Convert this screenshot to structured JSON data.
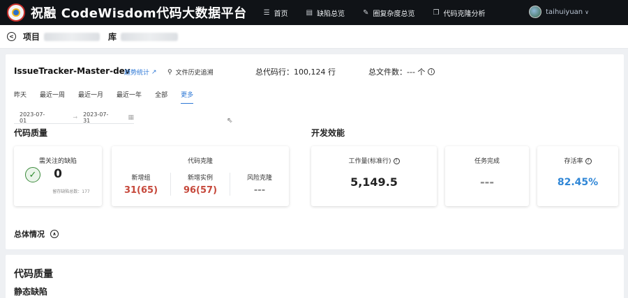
{
  "header": {
    "brand": "祝融 CodeWisdom代码大数据平台",
    "nav": [
      {
        "label": "首页",
        "icon": "menu-icon"
      },
      {
        "label": "缺陷总览",
        "icon": "document-icon"
      },
      {
        "label": "圈复杂度总览",
        "icon": "wrench-icon"
      },
      {
        "label": "代码克隆分析",
        "icon": "copy-icon"
      }
    ],
    "user": "taihuiyuan"
  },
  "breadcrumb": {
    "project_label": "项目",
    "repo_label": "库"
  },
  "repo": {
    "title": "IssueTracker-Master-dev",
    "trend_link": "趋势统计",
    "history_link": "文件历史追溯",
    "total_lines": "总代码行：100,124 行",
    "total_files": "总文件数：--- 个"
  },
  "tabs": [
    "昨天",
    "最近一周",
    "最近一月",
    "最近一年",
    "全部",
    "更多"
  ],
  "active_tab": "更多",
  "date_range": {
    "start": "2023-07-01",
    "end": "2023-07-31"
  },
  "sections": {
    "quality": "代码质量",
    "efficiency": "开发效能",
    "overall": "总体情况"
  },
  "cards": {
    "defects": {
      "title": "需关注的缺陷",
      "value": "0",
      "hint": "留存缺陷总数：177"
    },
    "clone": {
      "title": "代码克隆",
      "cols": [
        {
          "label": "新增组",
          "value": "31(65)"
        },
        {
          "label": "新增实例",
          "value": "96(57)"
        },
        {
          "label": "风险克隆",
          "value": "---"
        }
      ]
    },
    "workload": {
      "title": "工作量(标准行)",
      "value": "5,149.5"
    },
    "tasks": {
      "title": "任务完成",
      "value": "---"
    },
    "survival": {
      "title": "存活率",
      "value": "82.45%"
    }
  },
  "lower": {
    "title": "代码质量",
    "subtitle": "静态缺陷"
  },
  "colors": {
    "accent": "#2e78d6",
    "red_value": "#c6483b",
    "blue_value": "#2f86d6",
    "topbar": "#101317"
  }
}
